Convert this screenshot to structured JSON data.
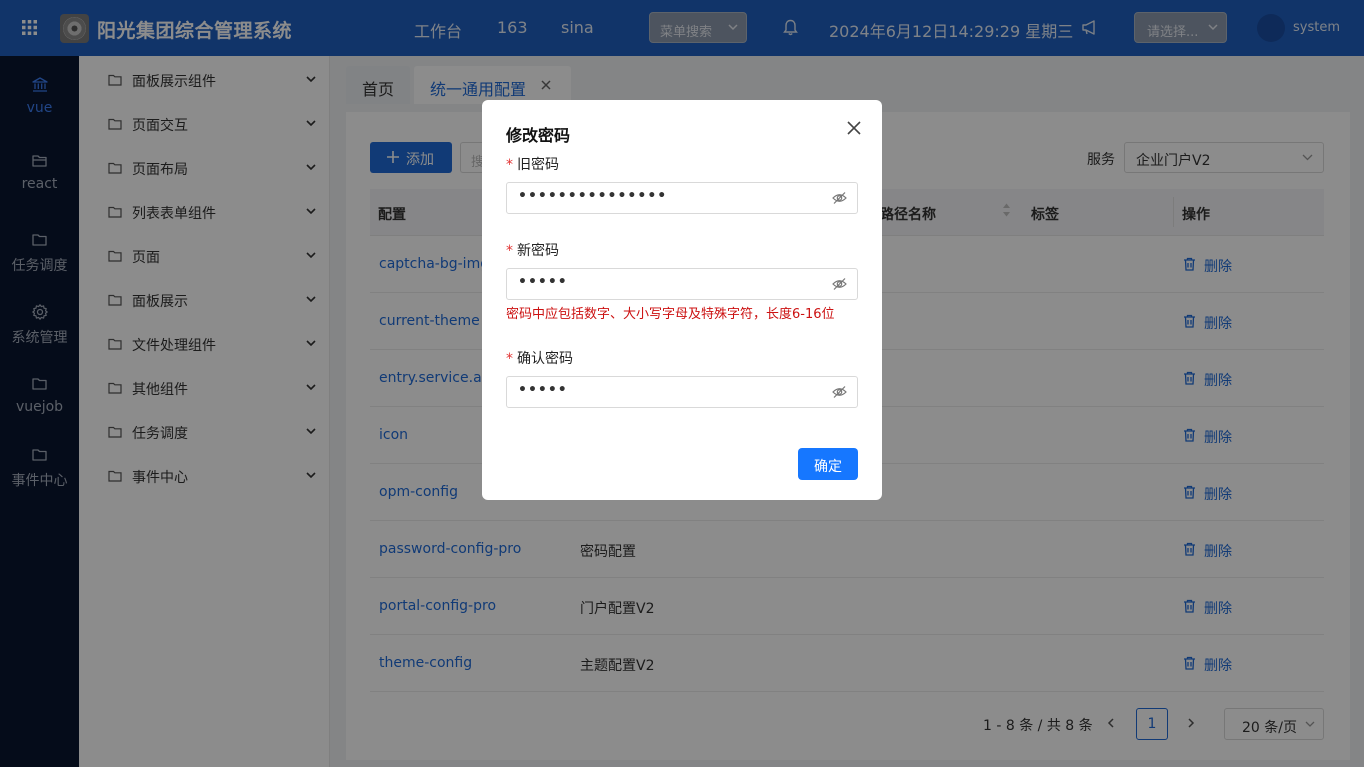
{
  "header": {
    "title": "阳光集团综合管理系统",
    "nav": [
      "工作台",
      "163",
      "sina"
    ],
    "menu_search": "菜单搜索",
    "datetime": "2024年6月12日14:29:29 星期三",
    "select_placeholder": "请选择...",
    "username": "system"
  },
  "rail": {
    "items": [
      {
        "label": "vue",
        "icon": "bank-icon",
        "active": true
      },
      {
        "label": "react",
        "icon": "folder-open-icon"
      },
      {
        "label": "任务调度",
        "icon": "folder-icon"
      },
      {
        "label": "系统管理",
        "icon": "gear-icon"
      },
      {
        "label": "vuejob",
        "icon": "folder-icon"
      },
      {
        "label": "事件中心",
        "icon": "folder-icon"
      }
    ]
  },
  "submenu": {
    "items": [
      "面板展示组件",
      "页面交互",
      "页面布局",
      "列表表单组件",
      "页面",
      "面板展示",
      "文件处理组件",
      "其他组件",
      "任务调度",
      "事件中心"
    ]
  },
  "tabs": [
    {
      "label": "首页"
    },
    {
      "label": "统一通用配置",
      "active": true
    }
  ],
  "toolbar": {
    "add_label": "添加",
    "search_stub": "搜",
    "service_label": "服务",
    "service_value": "企业门户V2"
  },
  "table": {
    "headers": {
      "key": "配置",
      "route": "路径名称",
      "tag": "标签",
      "ops": "操作"
    },
    "delete_label": "删除",
    "rows": [
      {
        "key": "captcha-bg-img",
        "name": ""
      },
      {
        "key": "current-theme",
        "name": ""
      },
      {
        "key": "entry.service.ager",
        "name": ""
      },
      {
        "key": "icon",
        "name": ""
      },
      {
        "key": "opm-config",
        "name": ""
      },
      {
        "key": "password-config-pro",
        "name": "密码配置"
      },
      {
        "key": "portal-config-pro",
        "name": "门户配置V2"
      },
      {
        "key": "theme-config",
        "name": "主题配置V2"
      }
    ]
  },
  "pagination": {
    "info": "1 - 8 条 / 共 8 条",
    "current": "1",
    "size": "20 条/页"
  },
  "modal": {
    "title": "修改密码",
    "old_label": "旧密码",
    "old_value": "•••••••••••••••",
    "new_label": "新密码",
    "new_value": "•••••",
    "error": "密码中应包括数字、大小写字母及特殊字符，长度6-16位",
    "confirm_label": "确认密码",
    "confirm_value": "•••••",
    "ok": "确定"
  },
  "colors": {
    "header": "#1f5fbf",
    "rail": "#0a1630",
    "primary": "#1677ff",
    "error": "#cc1111"
  }
}
